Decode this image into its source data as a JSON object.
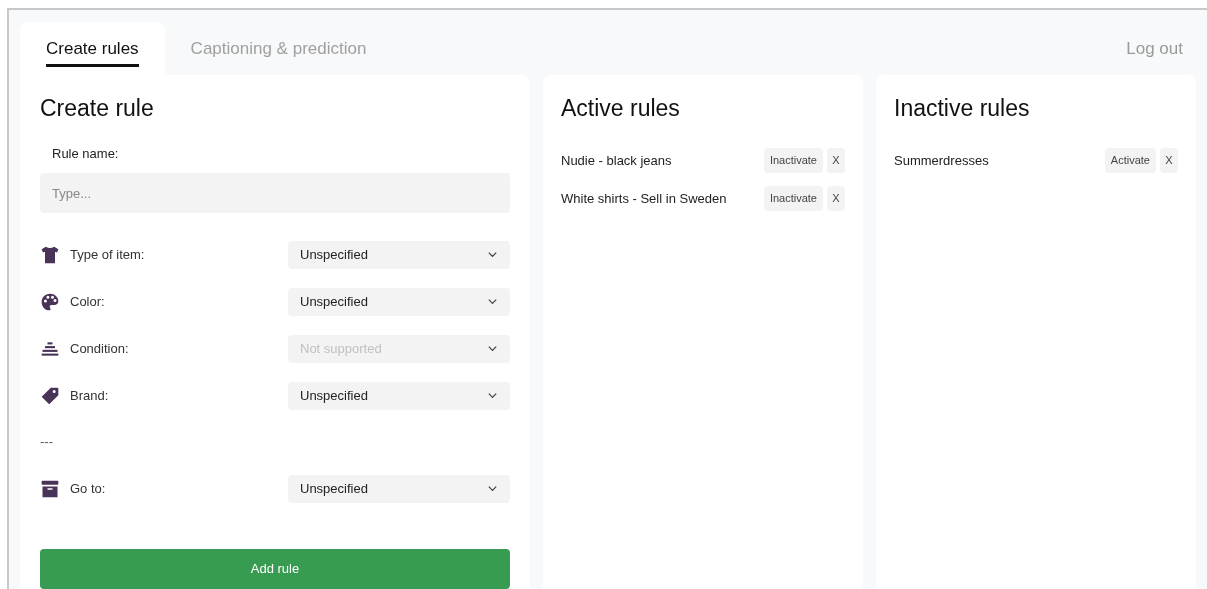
{
  "tabs": [
    {
      "label": "Create rules",
      "selected": true
    },
    {
      "label": "Captioning & prediction",
      "selected": false
    }
  ],
  "logout": "Log out",
  "create_rule": {
    "title": "Create rule",
    "name_label": "Rule name:",
    "name_placeholder": "Type...",
    "fields": [
      {
        "kind": "select",
        "label": "Type of item:",
        "value": "Unspecified",
        "disabled": false
      },
      {
        "kind": "select",
        "label": "Color:",
        "value": "Unspecified",
        "disabled": false
      },
      {
        "kind": "select",
        "label": "Condition:",
        "value": "Not supported",
        "disabled": true
      },
      {
        "kind": "select",
        "label": "Brand:",
        "value": "Unspecified",
        "disabled": false
      },
      {
        "kind": "separator",
        "label": "---"
      },
      {
        "kind": "select",
        "label": "Go to:",
        "value": "Unspecified",
        "disabled": false
      }
    ],
    "submit": "Add rule"
  },
  "active_rules": {
    "title": "Active rules",
    "rules": [
      {
        "name": "Nudie - black jeans",
        "action": "Inactivate",
        "remove": "X"
      },
      {
        "name": "White shirts - Sell in Sweden",
        "action": "Inactivate",
        "remove": "X"
      }
    ]
  },
  "inactive_rules": {
    "title": "Inactive rules",
    "rules": [
      {
        "name": "Summerdresses",
        "action": "Activate",
        "remove": "X"
      }
    ]
  }
}
